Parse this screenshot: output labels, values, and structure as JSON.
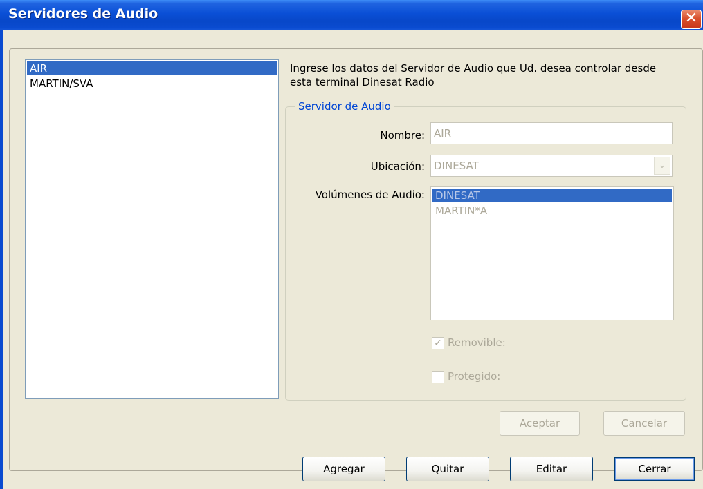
{
  "window": {
    "title": "Servidores de Audio",
    "close_glyph": "✕"
  },
  "servers": {
    "items": [
      "AIR",
      "MARTIN/SVA"
    ],
    "selected_index": 0
  },
  "intro_text": "Ingrese los datos del Servidor de Audio que Ud. desea controlar desde esta terminal Dinesat Radio",
  "group": {
    "legend": "Servidor de Audio",
    "nombre_label": "Nombre:",
    "nombre_value": "AIR",
    "ubicacion_label": "Ubicación:",
    "ubicacion_value": "DINESAT",
    "volumenes_label": "Volúmenes de Audio:",
    "volumenes": [
      "DINESAT",
      "MARTIN*A"
    ],
    "volumenes_selected_index": 0,
    "removible_label": "Removible:",
    "removible_checked": true,
    "protegido_label": "Protegido:",
    "protegido_checked": false,
    "check_glyph": "✓",
    "dropdown_glyph": "⌄"
  },
  "form_buttons": {
    "aceptar": "Aceptar",
    "cancelar": "Cancelar"
  },
  "bottom_buttons": {
    "agregar": "Agregar",
    "quitar": "Quitar",
    "editar": "Editar",
    "cerrar": "Cerrar"
  },
  "colors": {
    "titlebar": "#0a4fd6",
    "selection": "#316ac5",
    "legend": "#0046d5",
    "dialog_bg": "#ece9d8"
  }
}
